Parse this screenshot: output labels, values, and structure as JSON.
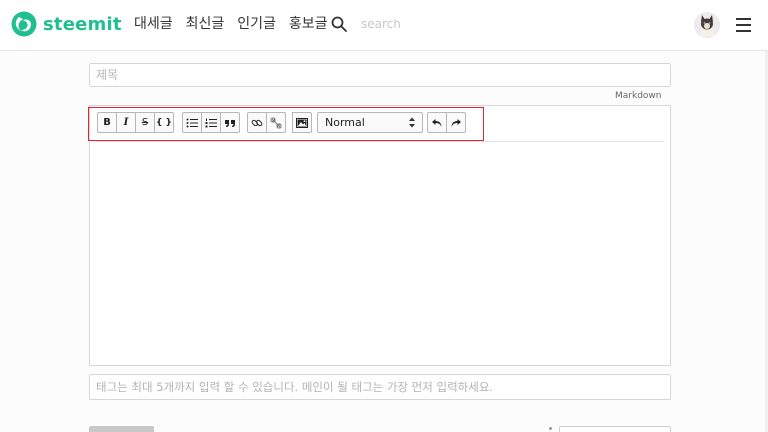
{
  "brand": {
    "name": "steemit",
    "color": "#1fbf8f"
  },
  "nav": {
    "items": [
      "대세글",
      "최신글",
      "인기글",
      "홍보글"
    ]
  },
  "search": {
    "placeholder": "search",
    "icon": "search-icon"
  },
  "header": {
    "avatar_icon": "cat-avatar",
    "menu_icon": "hamburger-icon"
  },
  "editor": {
    "title_placeholder": "제목",
    "markdown_label": "Markdown",
    "toolbar": {
      "format_buttons": [
        "B",
        "I",
        "S",
        "{ }"
      ],
      "list_buttons": [
        "bullet-list-icon",
        "numbered-list-icon",
        "quote-icon"
      ],
      "link_buttons": [
        "link-icon",
        "unlink-icon"
      ],
      "image_button": "image-icon",
      "heading_select": "Normal",
      "history_buttons": [
        "undo-icon",
        "redo-icon"
      ]
    },
    "highlight_color": "#e0272f",
    "body": ""
  },
  "tags": {
    "placeholder": "태그는 최대 5개까지 입력 할 수 있습니다. 메인이 될 태그는 가장 먼저 입력하세요."
  }
}
